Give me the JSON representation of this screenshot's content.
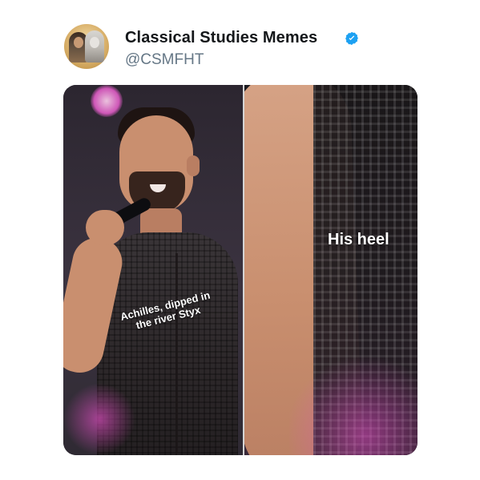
{
  "tweet": {
    "display_name": "Classical Studies Memes",
    "handle": "@CSMFHT",
    "verified": true
  },
  "media": {
    "left_caption": "Achilles, dipped in the river Styx",
    "right_caption": "His heel"
  },
  "colors": {
    "verified_blue": "#1DA1F2",
    "name_text": "#14171A",
    "handle_text": "#657786"
  },
  "icons": {
    "verified": "verified-badge-icon"
  }
}
